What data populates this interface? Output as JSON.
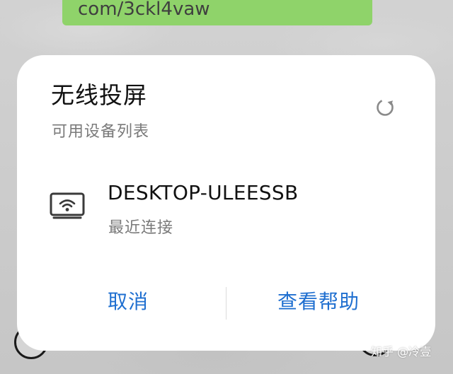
{
  "background": {
    "link_text": "com/3ckl4vaw"
  },
  "dialog": {
    "title": "无线投屏",
    "subtitle": "可用设备列表",
    "refresh_icon": "refresh-icon",
    "devices": [
      {
        "icon": "tv-cast-icon",
        "name": "DESKTOP-ULEESSB",
        "status": "最近连接"
      }
    ],
    "actions": {
      "cancel": "取消",
      "help": "查看帮助"
    }
  },
  "watermark": "知乎 @冷壹",
  "colors": {
    "accent": "#1f6fd0",
    "bubble": "#8fd36a",
    "title": "#111111",
    "secondary": "#7a7a7a"
  }
}
